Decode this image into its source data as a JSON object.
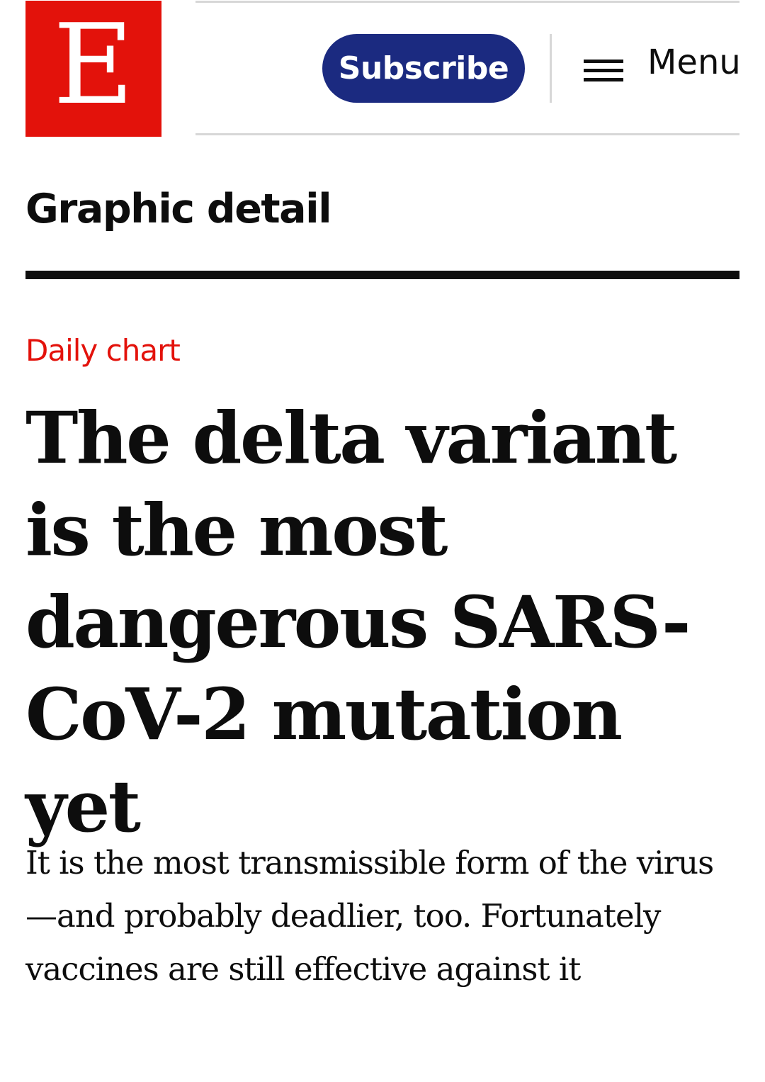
{
  "header": {
    "logo_letter": "E",
    "subscribe_label": "Subscribe",
    "menu_label": "Menu",
    "menu_icon": "hamburger-icon"
  },
  "section": {
    "title": "Graphic detail"
  },
  "article": {
    "rubric": "Daily chart",
    "headline": "The delta variant is the most dangerous SARS-CoV-2 mutation yet",
    "standfirst": "It is the most transmissible form of the virus—and probably deadlier, too. Fortunately vaccines are still effective against it"
  },
  "colors": {
    "brand_red": "#e3120b",
    "subscribe_blue": "#1b2a80",
    "text": "#0d0d0d",
    "rule_grey": "#d7d7d7"
  }
}
